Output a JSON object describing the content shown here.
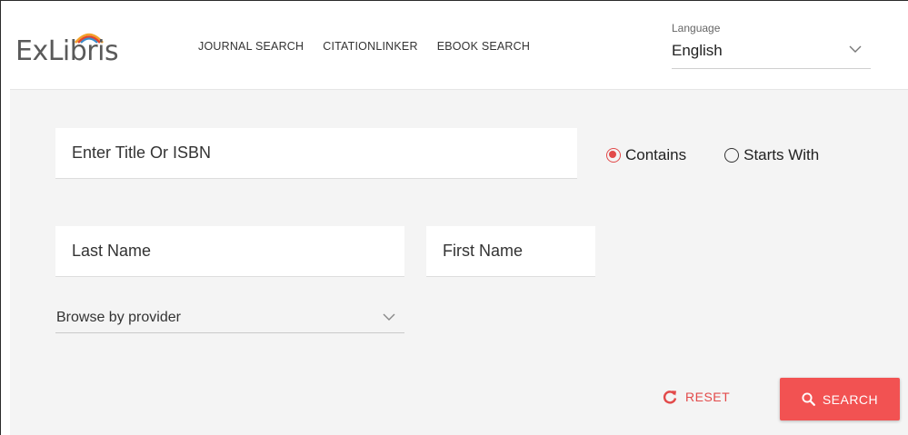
{
  "brand": {
    "name": "ExLibris"
  },
  "nav": {
    "items": [
      {
        "label": "JOURNAL SEARCH"
      },
      {
        "label": "CITATIONLINKER"
      },
      {
        "label": "EBOOK SEARCH"
      }
    ]
  },
  "language": {
    "label": "Language",
    "value": "English",
    "icon": "chevron-down-icon"
  },
  "search": {
    "title_placeholder": "Enter Title Or ISBN",
    "last_name_placeholder": "Last Name",
    "first_name_placeholder": "First Name",
    "match_options": [
      {
        "label": "Contains",
        "checked": true
      },
      {
        "label": "Starts With",
        "checked": false
      }
    ],
    "browse": {
      "label": "Browse by provider",
      "icon": "chevron-down-icon"
    },
    "reset_label": "RESET",
    "search_label": "SEARCH"
  },
  "colors": {
    "accent": "#f25252",
    "panel_bg": "#f4f4f4",
    "text": "#333333"
  }
}
